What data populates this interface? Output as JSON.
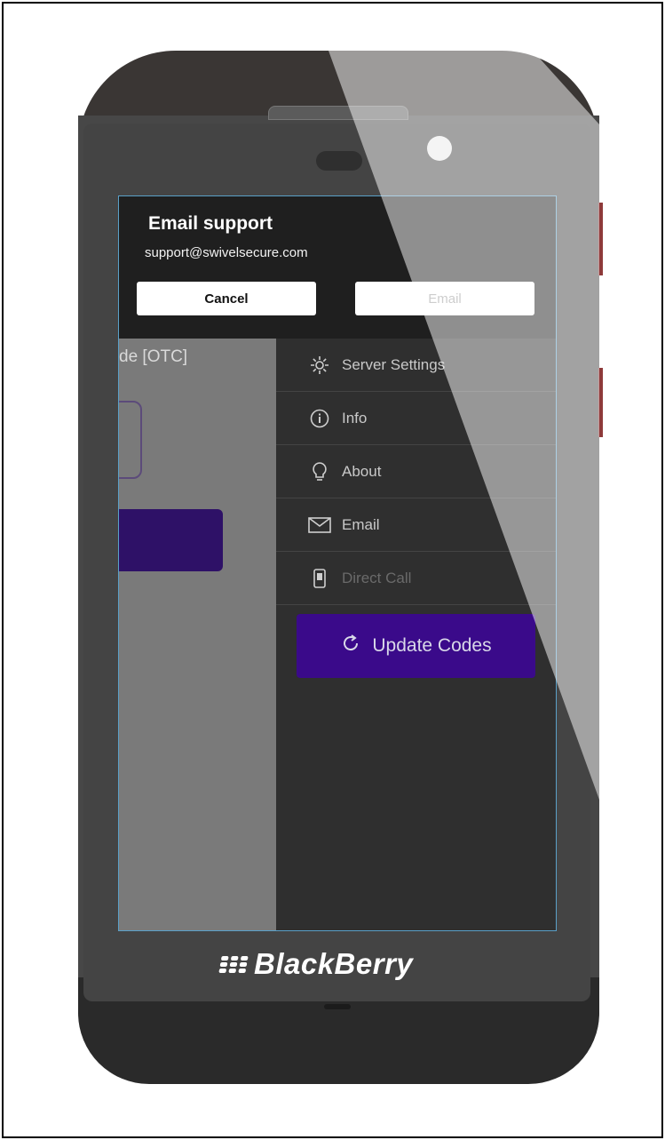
{
  "dialog": {
    "title": "Email support",
    "subtitle": "support@swivelsecure.com",
    "cancel_label": "Cancel",
    "email_label": "Email"
  },
  "background": {
    "otc_label": "de [OTC]"
  },
  "menu": {
    "items": [
      {
        "label": "Server Settings",
        "icon": "gear-icon"
      },
      {
        "label": "Info",
        "icon": "info-icon"
      },
      {
        "label": "About",
        "icon": "lightbulb-icon"
      },
      {
        "label": "Email",
        "icon": "envelope-icon"
      },
      {
        "label": "Direct Call",
        "icon": "phone-icon"
      }
    ],
    "update_label": "Update Codes"
  },
  "device": {
    "brand": "BlackBerry"
  },
  "colors": {
    "accent": "#3a0a8a",
    "dialog_bg": "#1f1f1f"
  }
}
